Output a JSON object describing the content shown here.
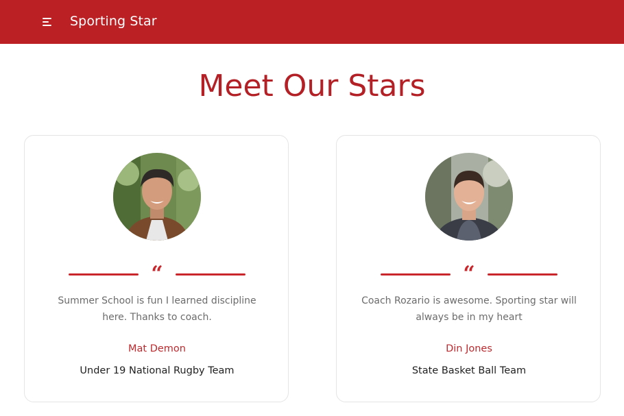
{
  "navbar": {
    "brand": "Sporting Star",
    "menu_icon": "menu-icon",
    "background": "#bb2024"
  },
  "page": {
    "title": "Meet Our Stars",
    "accent_color": "#c8262b"
  },
  "testimonials": [
    {
      "quote_icon": "quote-icon",
      "text": "Summer School is fun I learned discipline here. Thanks to coach.",
      "name": "Mat Demon",
      "team": "Under 19 National Rugby Team"
    },
    {
      "quote_icon": "quote-icon",
      "text": "Coach Rozario is awesome. Sporting star will always be in my heart",
      "name": "Din Jones",
      "team": "State Basket Ball Team"
    }
  ]
}
